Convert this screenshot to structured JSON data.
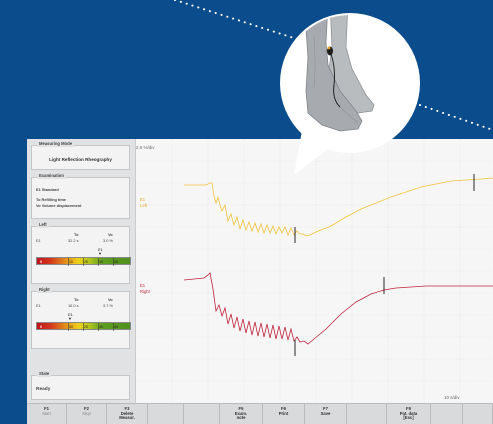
{
  "sidebar": {
    "measuring_mode": {
      "title": "Measuring Mode",
      "value": "Light Reflection Rheography"
    },
    "examination": {
      "title": "Examination",
      "line1": "E1 Standard",
      "line2": "To Refilling time",
      "line3": "Vo Volume displacement"
    },
    "left": {
      "title": "Left",
      "col_to": "To",
      "col_vo": "Vo",
      "row_label": "E1",
      "to_value": "32.2 s",
      "vo_value": "3.0 %",
      "scale_zero": "0",
      "ticks": [
        "10",
        "25",
        "35",
        "45"
      ],
      "marker": "E1"
    },
    "right": {
      "title": "Right",
      "col_to": "To",
      "col_vo": "Vo",
      "row_label": "E1",
      "to_value": "16.0 s",
      "vo_value": "3.7 %",
      "scale_zero": "0",
      "ticks": [
        "10",
        "25",
        "35",
        "45"
      ],
      "marker": "E1"
    },
    "state": {
      "title": "State",
      "value": "Ready"
    }
  },
  "plot": {
    "y_scale": "2.0 %/div",
    "x_scale": "10 s/div",
    "left_label": {
      "line1": "E1",
      "line2": "Left"
    },
    "right_label": {
      "line1": "E1",
      "line2": "Right"
    }
  },
  "colors": {
    "left_curve": "#f0c33a",
    "right_curve": "#c0243c",
    "background": "#0b4d8c"
  },
  "fkeys": [
    {
      "key": "F1",
      "label": "Start",
      "state": "dim"
    },
    {
      "key": "F2",
      "label": "Stop",
      "state": "dim"
    },
    {
      "key": "F3",
      "label": "Delete\nMeasur.",
      "state": "bold"
    },
    {
      "key": "",
      "label": "",
      "state": ""
    },
    {
      "key": "",
      "label": "",
      "state": ""
    },
    {
      "key": "F5",
      "label": "Exam.\nnote",
      "state": "bold"
    },
    {
      "key": "F6",
      "label": "Print",
      "state": "bold"
    },
    {
      "key": "F7",
      "label": "Save",
      "state": "bold"
    },
    {
      "key": "",
      "label": "",
      "state": ""
    },
    {
      "key": "F9",
      "label": "Pat. data\n[Esc]",
      "state": "bold"
    },
    {
      "key": "",
      "label": "",
      "state": ""
    },
    {
      "key": "",
      "label": "",
      "state": ""
    }
  ],
  "illustration": {
    "icon": "feet-with-sensor-icon"
  }
}
